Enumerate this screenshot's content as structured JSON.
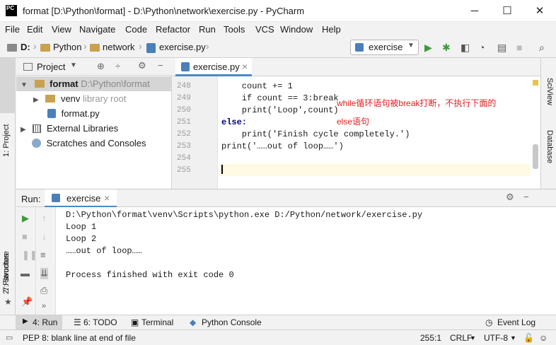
{
  "window": {
    "title": "format [D:\\Python\\format] - D:\\Python\\network\\exercise.py - PyCharm",
    "logo": "PC",
    "min": "─",
    "max": "☐",
    "close": "✕"
  },
  "menu": [
    "File",
    "Edit",
    "View",
    "Navigate",
    "Code",
    "Refactor",
    "Run",
    "Tools",
    "VCS",
    "Window",
    "Help"
  ],
  "breadcrumb": {
    "drive": "D:",
    "items": [
      "Python",
      "network",
      "exercise.py"
    ]
  },
  "run_config": "exercise",
  "left_strip": {
    "project": "1: Project",
    "structure": "7: Structure",
    "favorites": "2: Favorites"
  },
  "right_strip": {
    "sciview": "SciView",
    "database": "Database"
  },
  "project_panel": {
    "header": "Project",
    "items": [
      {
        "name": "format",
        "path": "D:\\Python\\format"
      },
      {
        "name": "venv",
        "note": "library root"
      },
      {
        "name": "format.py"
      },
      {
        "name": "External Libraries"
      },
      {
        "name": "Scratches and Consoles"
      }
    ]
  },
  "editor": {
    "tab": "exercise.py",
    "tab_close": "×",
    "lines": [
      {
        "n": "248",
        "code": "    count += 1"
      },
      {
        "n": "249",
        "code": "    if count == 3:break"
      },
      {
        "n": "250",
        "code": "    print('Loop',count)"
      },
      {
        "n": "251",
        "code": "else:"
      },
      {
        "n": "252",
        "code": "    print('Finish cycle completely.')"
      },
      {
        "n": "253",
        "code": "print('……out of loop……')"
      },
      {
        "n": "254",
        "code": ""
      },
      {
        "n": "255",
        "code": ""
      }
    ],
    "annotation1": "while循环语句被break打断，不执行下面的",
    "annotation2": "else语句"
  },
  "run_panel": {
    "label": "Run:",
    "tab": "exercise",
    "tab_close": "×",
    "output": [
      "D:\\Python\\format\\venv\\Scripts\\python.exe D:/Python/network/exercise.py",
      "Loop 1",
      "Loop 2",
      "……out of loop……",
      "",
      "Process finished with exit code 0"
    ]
  },
  "bottom_tabs": {
    "run": "4: Run",
    "todo": "6: TODO",
    "terminal": "Terminal",
    "python_console": "Python Console",
    "event_log": "Event Log"
  },
  "status": {
    "message": "PEP 8: blank line at end of file",
    "position": "255:1",
    "line_sep": "CRLF",
    "encoding": "UTF-8"
  },
  "colors": {
    "accent": "#4a88c7",
    "run_green": "#3c9a3c",
    "annotation_red": "#e02020"
  }
}
